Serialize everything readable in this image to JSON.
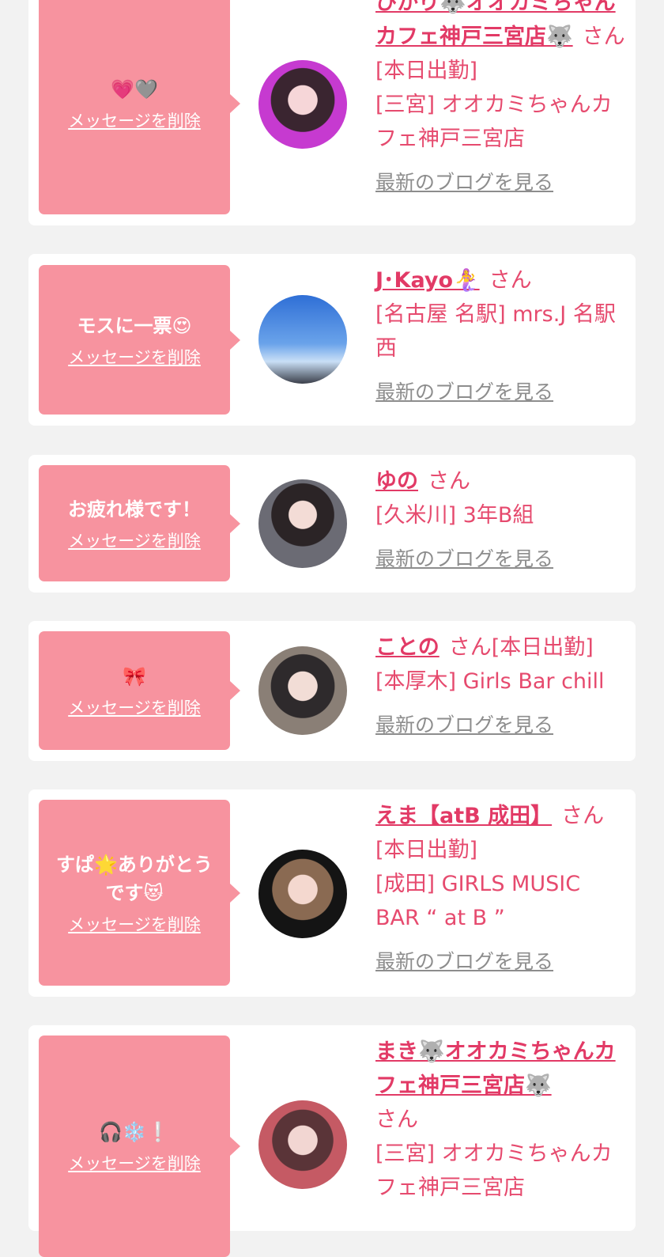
{
  "delete_label": "メッセージを削除",
  "blog_label": "最新のブログを見る",
  "san_suffix": "さん",
  "cards": [
    {
      "message": "💗🩶",
      "name": "ひかり🐺オオカミちゃんカフェ神戸三宮店🐺",
      "status": "[本日出勤]",
      "shop": "[三宮] オオカミちゃんカフェ神戸三宮店"
    },
    {
      "message": "モスに一票😍",
      "name": "J･Kayo🧜‍♀️",
      "status": "",
      "shop": "[名古屋 名駅] mrs.J 名駅西"
    },
    {
      "message": "お疲れ様です！",
      "name": "ゆの",
      "status": "",
      "shop": "[久米川] 3年B組"
    },
    {
      "message": "🎀",
      "name": "ことの",
      "status": "[本日出勤]",
      "shop": "[本厚木] Girls Bar chill"
    },
    {
      "message": "すぱ🌟ありがとう\nです😻",
      "name": "えま【atB 成田】",
      "status": "[本日出勤]",
      "shop": "[成田] GIRLS MUSIC BAR “ at B ”"
    },
    {
      "message": "🎧❄️❕",
      "name": "まき🐺オオカミちゃんカフェ神戸三宮店🐺",
      "status": "",
      "shop": "[三宮] オオカミちゃんカフェ神戸三宮店"
    }
  ]
}
